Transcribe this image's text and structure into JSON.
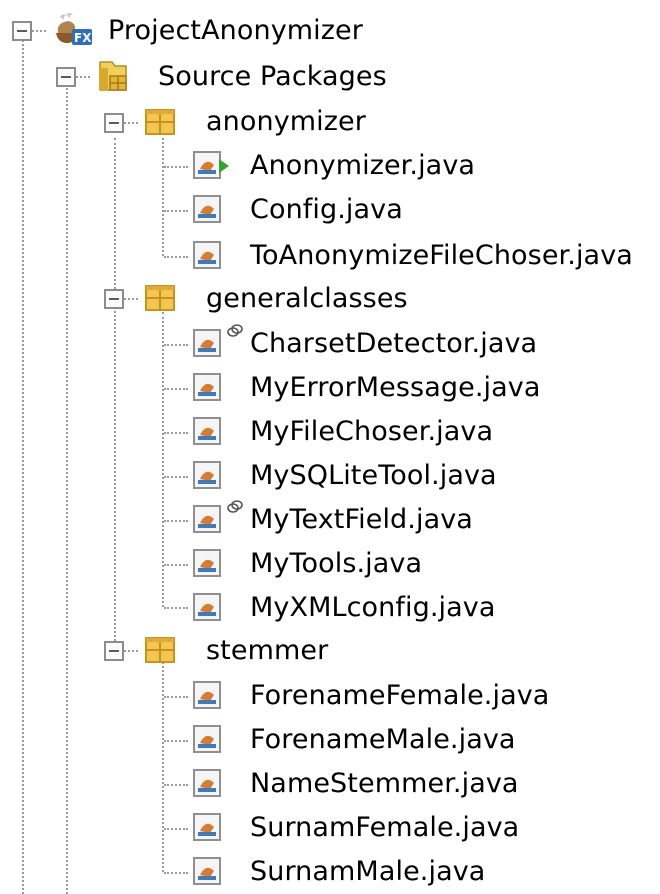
{
  "tree": {
    "project": {
      "label": "ProjectAnonymizer",
      "icon": "java-fx-project-icon"
    },
    "source_packages": {
      "label": "Source Packages",
      "icon": "source-packages-folder-icon"
    },
    "packages": [
      {
        "label": "anonymizer",
        "icon": "package-icon",
        "files": [
          {
            "label": "Anonymizer.java",
            "icon": "java-main-class-icon"
          },
          {
            "label": "Config.java",
            "icon": "java-class-icon"
          },
          {
            "label": "ToAnonymizeFileChoser.java",
            "icon": "java-class-icon"
          }
        ]
      },
      {
        "label": "generalclasses",
        "icon": "package-icon",
        "files": [
          {
            "label": "CharsetDetector.java",
            "icon": "java-class-icon",
            "badge": "link-badge-icon"
          },
          {
            "label": "MyErrorMessage.java",
            "icon": "java-class-icon"
          },
          {
            "label": "MyFileChoser.java",
            "icon": "java-class-icon"
          },
          {
            "label": "MySQLiteTool.java",
            "icon": "java-class-icon"
          },
          {
            "label": "MyTextField.java",
            "icon": "java-class-icon",
            "badge": "link-badge-icon"
          },
          {
            "label": "MyTools.java",
            "icon": "java-class-icon"
          },
          {
            "label": "MyXMLconfig.java",
            "icon": "java-class-icon"
          }
        ]
      },
      {
        "label": "stemmer",
        "icon": "package-icon",
        "files": [
          {
            "label": "ForenameFemale.java",
            "icon": "java-class-icon"
          },
          {
            "label": "ForenameMale.java",
            "icon": "java-class-icon"
          },
          {
            "label": "NameStemmer.java",
            "icon": "java-class-icon"
          },
          {
            "label": "SurnamFemale.java",
            "icon": "java-class-icon"
          },
          {
            "label": "SurnamMale.java",
            "icon": "java-class-icon"
          }
        ]
      }
    ]
  }
}
